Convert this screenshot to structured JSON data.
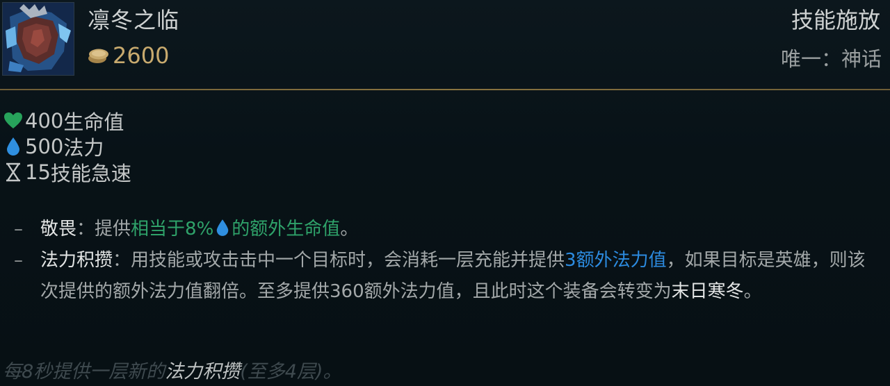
{
  "item": {
    "name": "凛冬之临",
    "cost": "2600",
    "category": "技能施放",
    "rarity": "唯一：神话"
  },
  "stats": [
    {
      "icon": "heart-icon",
      "value": "400",
      "label": "生命值",
      "color": "#27a35b"
    },
    {
      "icon": "mana-drop-icon",
      "value": "500",
      "label": "法力",
      "color": "#2f8fe0"
    },
    {
      "icon": "hourglass-icon",
      "value": "15",
      "label": "技能急速",
      "color": "#c4c7c7"
    }
  ],
  "passives": {
    "awe": {
      "name": "敬畏",
      "colon": "：",
      "pre": "提供",
      "green1": "相当于8%",
      "green2": "的额外生命值",
      "post": "。"
    },
    "mana_charge": {
      "name": "法力积攒",
      "colon": "：",
      "pre": "用技能或攻击击中一个目标时，会消耗一层充能并提供",
      "blue": "3额外法力值",
      "mid": "，如果目标是英雄，则该次提供的额外法力值翻倍。至多提供360额外法力值，且此时这个装备会转变为",
      "transform": "末日寒冬",
      "post": "。"
    }
  },
  "footer": {
    "pre": "每8秒提供一层新的",
    "highlight": "法力积攒",
    "post": "(至多4层)。"
  },
  "colors": {
    "gold": "#c8aa6e",
    "green": "#2fa36a",
    "blue": "#2c8be0",
    "divider": "#8a7440"
  }
}
